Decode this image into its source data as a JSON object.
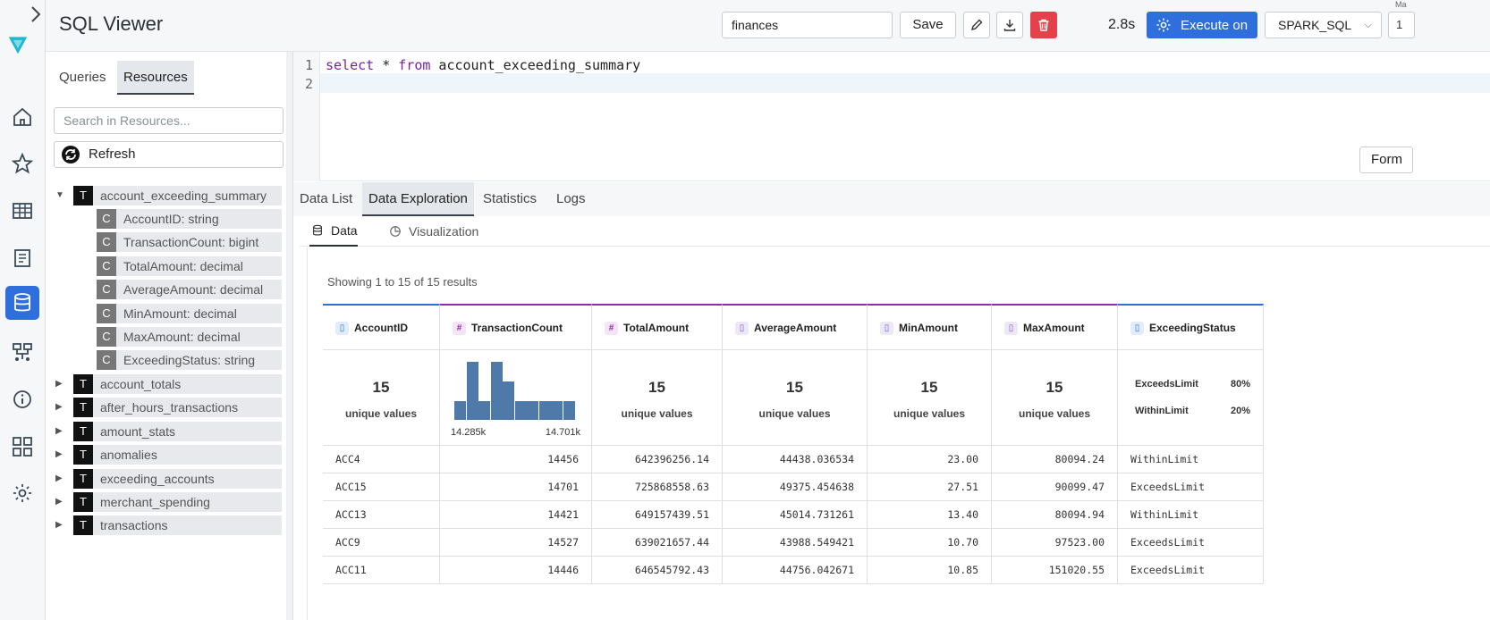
{
  "header": {
    "title": "SQL Viewer",
    "query_name": "finances",
    "save_label": "Save",
    "timing": "2.8s",
    "execute_label": "Execute on",
    "engine": "SPARK_SQL",
    "cut_label": "1",
    "cut_tiny": "Ma"
  },
  "left_panel": {
    "tabs": [
      "Queries",
      "Resources"
    ],
    "active_tab": "Resources",
    "search_placeholder": "Search in Resources...",
    "refresh_label": "Refresh",
    "expanded_table": {
      "badge": "T",
      "name": "account_exceeding_summary",
      "columns": [
        {
          "badge": "C",
          "label": "AccountID: string"
        },
        {
          "badge": "C",
          "label": "TransactionCount: bigint"
        },
        {
          "badge": "C",
          "label": "TotalAmount: decimal"
        },
        {
          "badge": "C",
          "label": "AverageAmount: decimal"
        },
        {
          "badge": "C",
          "label": "MinAmount: decimal"
        },
        {
          "badge": "C",
          "label": "MaxAmount: decimal"
        },
        {
          "badge": "C",
          "label": "ExceedingStatus: string"
        }
      ]
    },
    "other_tables": [
      {
        "badge": "T",
        "name": "account_totals"
      },
      {
        "badge": "T",
        "name": "after_hours_transactions"
      },
      {
        "badge": "T",
        "name": "amount_stats"
      },
      {
        "badge": "T",
        "name": "anomalies"
      },
      {
        "badge": "T",
        "name": "exceeding_accounts"
      },
      {
        "badge": "T",
        "name": "merchant_spending"
      },
      {
        "badge": "T",
        "name": "transactions"
      }
    ]
  },
  "editor": {
    "line_numbers": [
      "1",
      "2"
    ],
    "kw_select": "select",
    "star": " * ",
    "kw_from": "from",
    "table": " account_exceeding_summary",
    "format_label": "Form"
  },
  "result_tabs": [
    "Data List",
    "Data Exploration",
    "Statistics",
    "Logs"
  ],
  "active_result_tab": "Data Exploration",
  "sub_tabs": [
    "Data",
    "Visualization"
  ],
  "showing_text": "Showing 1 to 15 of 15 results",
  "columns": [
    {
      "name": "AccountID",
      "type_icon": "string",
      "glyph": "▯",
      "unique": "15",
      "unique_label": "unique values"
    },
    {
      "name": "TransactionCount",
      "type_icon": "number",
      "glyph": "#",
      "hist_min": "14.285k",
      "hist_max": "14.701k"
    },
    {
      "name": "TotalAmount",
      "type_icon": "number",
      "glyph": "#",
      "unique": "15",
      "unique_label": "unique values"
    },
    {
      "name": "AverageAmount",
      "type_icon": "decimal",
      "glyph": "▯",
      "unique": "15",
      "unique_label": "unique values"
    },
    {
      "name": "MinAmount",
      "type_icon": "decimal",
      "glyph": "▯",
      "unique": "15",
      "unique_label": "unique values"
    },
    {
      "name": "MaxAmount",
      "type_icon": "decimal",
      "glyph": "▯",
      "unique": "15",
      "unique_label": "unique values"
    },
    {
      "name": "ExceedingStatus",
      "type_icon": "string",
      "glyph": "▯",
      "categories": [
        {
          "label": "ExceedsLimit",
          "pct": "80%"
        },
        {
          "label": "WithinLimit",
          "pct": "20%"
        }
      ]
    }
  ],
  "histogram": {
    "bar_levels": [
      0.33,
      1.0,
      0.33,
      1.0,
      0.66,
      0.33,
      0.33,
      0.33,
      0.33,
      0.33
    ]
  },
  "rows": [
    [
      "ACC4",
      "14456",
      "642396256.14",
      "44438.036534",
      "23.00",
      "80094.24",
      "WithinLimit"
    ],
    [
      "ACC15",
      "14701",
      "725868558.63",
      "49375.454638",
      "27.51",
      "90099.47",
      "ExceedsLimit"
    ],
    [
      "ACC13",
      "14421",
      "649157439.51",
      "45014.731261",
      "13.40",
      "80094.94",
      "WithinLimit"
    ],
    [
      "ACC9",
      "14527",
      "639021657.44",
      "43988.549421",
      "10.70",
      "97523.00",
      "ExceedsLimit"
    ],
    [
      "ACC11",
      "14446",
      "646545792.43",
      "44756.042671",
      "10.85",
      "151020.55",
      "ExceedsLimit"
    ]
  ]
}
